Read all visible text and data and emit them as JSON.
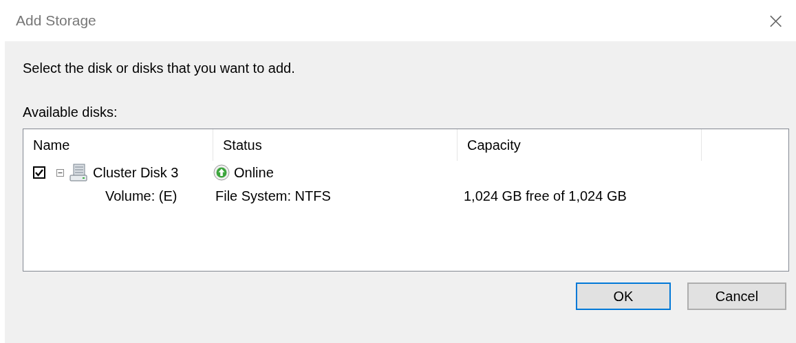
{
  "window": {
    "title": "Add Storage",
    "close": "×"
  },
  "instruction": "Select the disk or disks that you want to add.",
  "list_label": "Available disks:",
  "table": {
    "columns": [
      "Name",
      "Status",
      "Capacity"
    ],
    "rows": [
      {
        "name": "Cluster Disk 3",
        "checked": true,
        "expanded": true,
        "status": "Online",
        "volume": "Volume: (E)",
        "file_system": "File System: NTFS",
        "capacity": "1,024 GB free of 1,024 GB"
      }
    ]
  },
  "buttons": [
    {
      "label": "OK",
      "default": true
    },
    {
      "label": "Cancel",
      "default": false
    }
  ]
}
